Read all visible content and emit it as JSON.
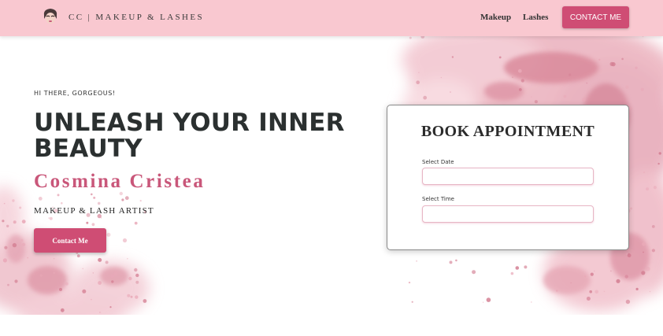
{
  "header": {
    "brand": "CC | MAKEUP & LASHES",
    "logo_icon": "woman-face-logo-icon",
    "nav": {
      "makeup": "Makeup",
      "lashes": "Lashes",
      "contact": "CONTACT ME"
    }
  },
  "hero": {
    "greeting": "HI THERE, GORGEOUS!",
    "headline": "UNLEASH YOUR INNER BEAUTY",
    "artist_name": "Cosmina Cristea",
    "tagline": "MAKEUP & LASH ARTIST",
    "contact_button": "Contact Me",
    "background": "pink-makeup-powder-splash"
  },
  "booking": {
    "title": "BOOK APPOINTMENT",
    "date_label": "Select Date",
    "date_value": "",
    "time_label": "Select Time",
    "time_value": ""
  },
  "colors": {
    "header_bg": "#f9c8d0",
    "accent": "#cf4d74",
    "name_color": "#c9577a",
    "heading_color": "#2b3030"
  }
}
